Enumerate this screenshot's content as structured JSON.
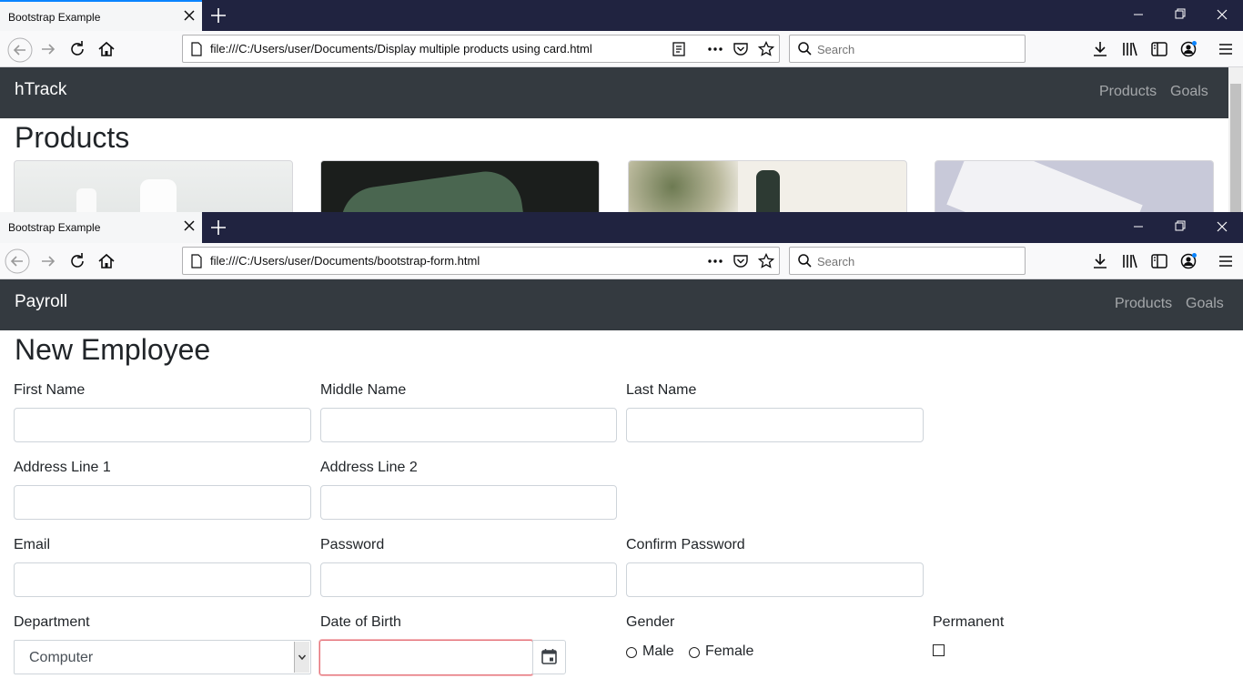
{
  "window1": {
    "tab_title": "Bootstrap Example",
    "url": "file:///C:/Users/user/Documents/Display multiple products using card.html",
    "search_placeholder": "Search",
    "brand": "hTrack",
    "nav_links": [
      "Products",
      "Goals"
    ],
    "heading": "Products"
  },
  "window2": {
    "tab_title": "Bootstrap Example",
    "url": "file:///C:/Users/user/Documents/bootstrap-form.html",
    "search_placeholder": "Search",
    "brand": "Payroll",
    "nav_links": [
      "Products",
      "Goals"
    ],
    "heading": "New Employee",
    "form": {
      "first_name": {
        "label": "First Name",
        "value": ""
      },
      "middle_name": {
        "label": "Middle Name",
        "value": ""
      },
      "last_name": {
        "label": "Last Name",
        "value": ""
      },
      "address1": {
        "label": "Address Line 1",
        "value": ""
      },
      "address2": {
        "label": "Address Line 2",
        "value": ""
      },
      "email": {
        "label": "Email",
        "value": ""
      },
      "password": {
        "label": "Password",
        "value": ""
      },
      "confirm_password": {
        "label": "Confirm Password",
        "value": ""
      },
      "department": {
        "label": "Department",
        "selected": "Computer"
      },
      "dob": {
        "label": "Date of Birth",
        "value": ""
      },
      "gender": {
        "label": "Gender",
        "options": [
          "Male",
          "Female"
        ],
        "selected": null
      },
      "permanent": {
        "label": "Permanent",
        "checked": false
      }
    }
  },
  "colors": {
    "tabbar": "#202340",
    "navbar": "#343a40",
    "accent": "#0a84ff",
    "invalid_border": "#e5737a"
  },
  "icons": [
    "back-icon",
    "forward-icon",
    "reload-icon",
    "home-icon",
    "page-icon",
    "reader-view-icon",
    "more-icon",
    "pocket-icon",
    "bookmark-star-icon",
    "search-icon",
    "download-icon",
    "library-icon",
    "sidebar-icon",
    "account-icon",
    "menu-icon",
    "close-icon",
    "plus-icon",
    "minimize-icon",
    "restore-icon",
    "calendar-icon"
  ]
}
